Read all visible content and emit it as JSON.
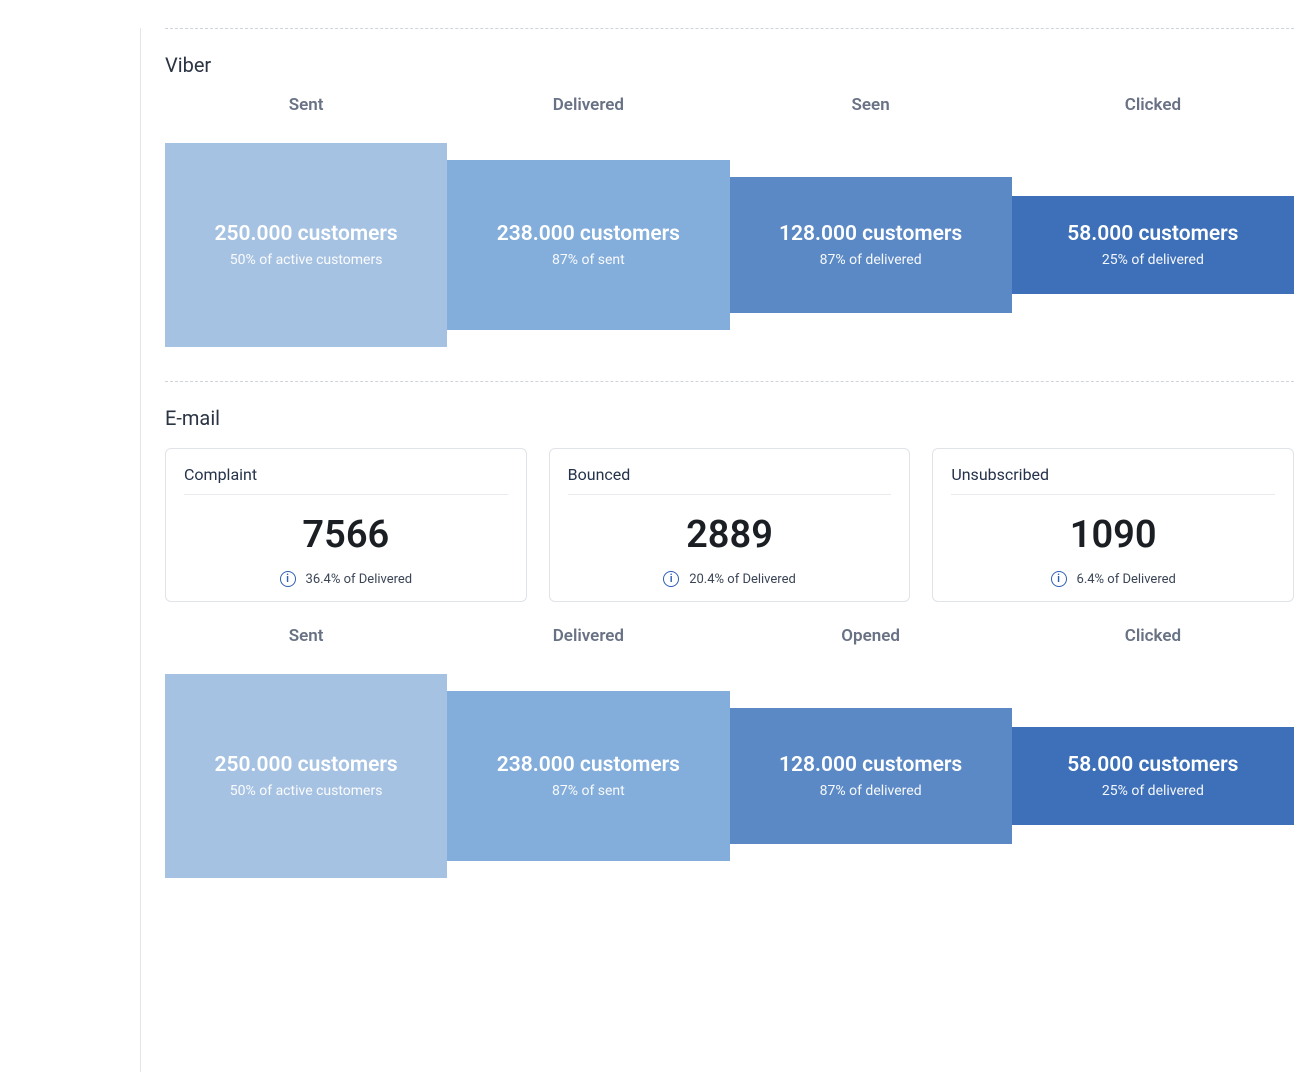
{
  "viber": {
    "title": "Viber",
    "headers": [
      "Sent",
      "Delivered",
      "Seen",
      "Clicked"
    ],
    "steps": [
      {
        "value": "250.000 customers",
        "sub": "50% of active customers"
      },
      {
        "value": "238.000 customers",
        "sub": "87% of sent"
      },
      {
        "value": "128.000 customers",
        "sub": "87% of delivered"
      },
      {
        "value": "58.000 customers",
        "sub": "25% of delivered"
      }
    ]
  },
  "email": {
    "title": "E-mail",
    "cards": [
      {
        "title": "Complaint",
        "value": "7566",
        "foot": "36.4% of Delivered"
      },
      {
        "title": "Bounced",
        "value": "2889",
        "foot": "20.4% of Delivered"
      },
      {
        "title": "Unsubscribed",
        "value": "1090",
        "foot": "6.4% of Delivered"
      }
    ],
    "headers": [
      "Sent",
      "Delivered",
      "Opened",
      "Clicked"
    ],
    "steps": [
      {
        "value": "250.000 customers",
        "sub": "50% of active customers"
      },
      {
        "value": "238.000 customers",
        "sub": "87% of sent"
      },
      {
        "value": "128.000 customers",
        "sub": "87% of delivered"
      },
      {
        "value": "58.000 customers",
        "sub": "25% of delivered"
      }
    ]
  },
  "chart_data": [
    {
      "type": "bar",
      "title": "Viber funnel",
      "categories": [
        "Sent",
        "Delivered",
        "Seen",
        "Clicked"
      ],
      "series": [
        {
          "name": "customers",
          "values": [
            250000,
            238000,
            128000,
            58000
          ]
        }
      ],
      "annotations": [
        "50% of active customers",
        "87% of sent",
        "87% of delivered",
        "25% of delivered"
      ]
    },
    {
      "type": "table",
      "title": "E-mail summary",
      "categories": [
        "Complaint",
        "Bounced",
        "Unsubscribed"
      ],
      "values": [
        7566,
        2889,
        1090
      ],
      "annotations": [
        "36.4% of Delivered",
        "20.4% of Delivered",
        "6.4% of Delivered"
      ]
    },
    {
      "type": "bar",
      "title": "E-mail funnel",
      "categories": [
        "Sent",
        "Delivered",
        "Opened",
        "Clicked"
      ],
      "series": [
        {
          "name": "customers",
          "values": [
            250000,
            238000,
            128000,
            58000
          ]
        }
      ],
      "annotations": [
        "50% of active customers",
        "87% of sent",
        "87% of delivered",
        "25% of delivered"
      ]
    }
  ]
}
